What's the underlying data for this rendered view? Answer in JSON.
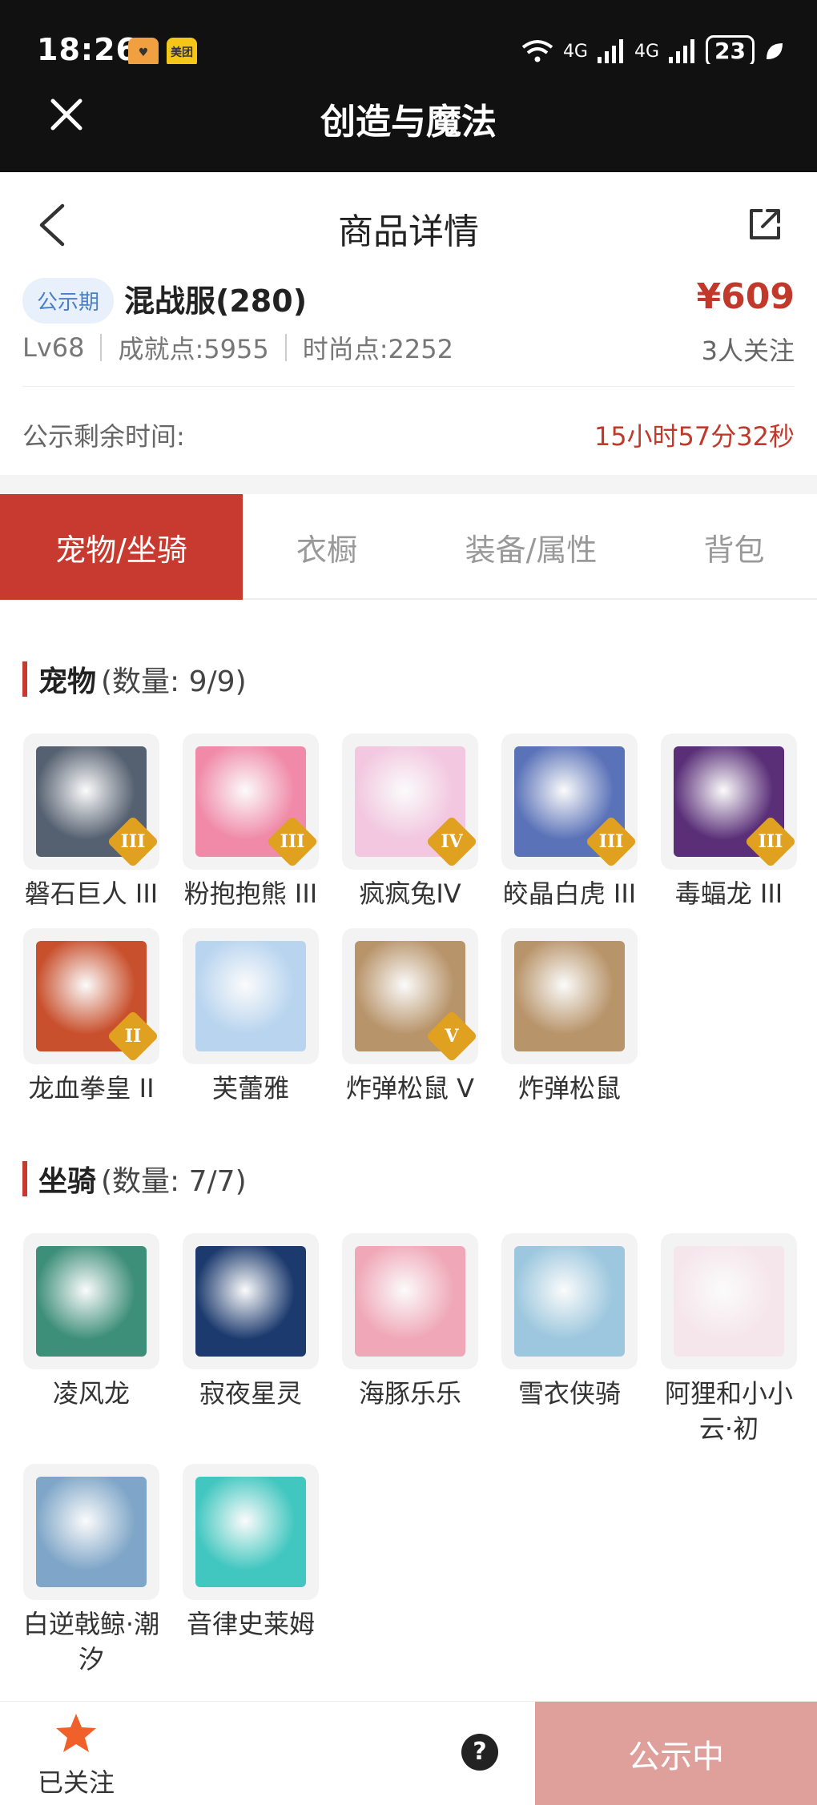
{
  "status_bar": {
    "time": "18:26",
    "app_badges": [
      {
        "text": "♥",
        "color": "#f0a040"
      },
      {
        "text": "美团",
        "color": "#f5c518"
      }
    ],
    "network": "4G",
    "battery": "23"
  },
  "web_title": "创造与魔法",
  "nav": {
    "title": "商品详情"
  },
  "product": {
    "tag": "公示期",
    "name": "混战服(280)",
    "price": "¥609",
    "level": "Lv68",
    "achievement": "成就点:5955",
    "fashion": "时尚点:2252",
    "followers": "3人关注"
  },
  "timer": {
    "label": "公示剩余时间:",
    "value": "15小时57分32秒"
  },
  "tabs": [
    {
      "label": "宠物/坐骑",
      "active": true
    },
    {
      "label": "衣橱",
      "active": false
    },
    {
      "label": "装备/属性",
      "active": false
    },
    {
      "label": "背包",
      "active": false
    }
  ],
  "pets": {
    "title": "宠物",
    "count": "(数量: 9/9)",
    "items": [
      {
        "name": "磐石巨人 III",
        "rank": "III",
        "color": "#556070"
      },
      {
        "name": "粉抱抱熊 III",
        "rank": "III",
        "color": "#f08aa8"
      },
      {
        "name": "疯疯兔IV",
        "rank": "IV",
        "color": "#f2c7df"
      },
      {
        "name": "皎晶白虎 III",
        "rank": "III",
        "color": "#5a72b8"
      },
      {
        "name": "毒蝠龙 III",
        "rank": "III",
        "color": "#5a2f78"
      },
      {
        "name": "龙血拳皇 II",
        "rank": "II",
        "color": "#c8502d"
      },
      {
        "name": "芙蕾雅",
        "rank": "",
        "color": "#b8d4ef"
      },
      {
        "name": "炸弹松鼠 V",
        "rank": "V",
        "color": "#b8946a"
      },
      {
        "name": "炸弹松鼠",
        "rank": "",
        "color": "#b8946a"
      }
    ]
  },
  "mounts": {
    "title": "坐骑",
    "count": "(数量: 7/7)",
    "items": [
      {
        "name": "凌风龙",
        "color": "#3e8f7a"
      },
      {
        "name": "寂夜星灵",
        "color": "#1c3a6e"
      },
      {
        "name": "海豚乐乐",
        "color": "#f0a8b8"
      },
      {
        "name": "雪衣侠骑",
        "color": "#9cc7de"
      },
      {
        "name": "阿狸和小小云·初",
        "color": "#f5e6ec"
      },
      {
        "name": "白逆戟鲸·潮汐",
        "color": "#7fa6c8"
      },
      {
        "name": "音律史莱姆",
        "color": "#42c7c0"
      }
    ]
  },
  "bottom": {
    "follow_label": "已关注",
    "help": "?",
    "status_label": "公示中"
  }
}
